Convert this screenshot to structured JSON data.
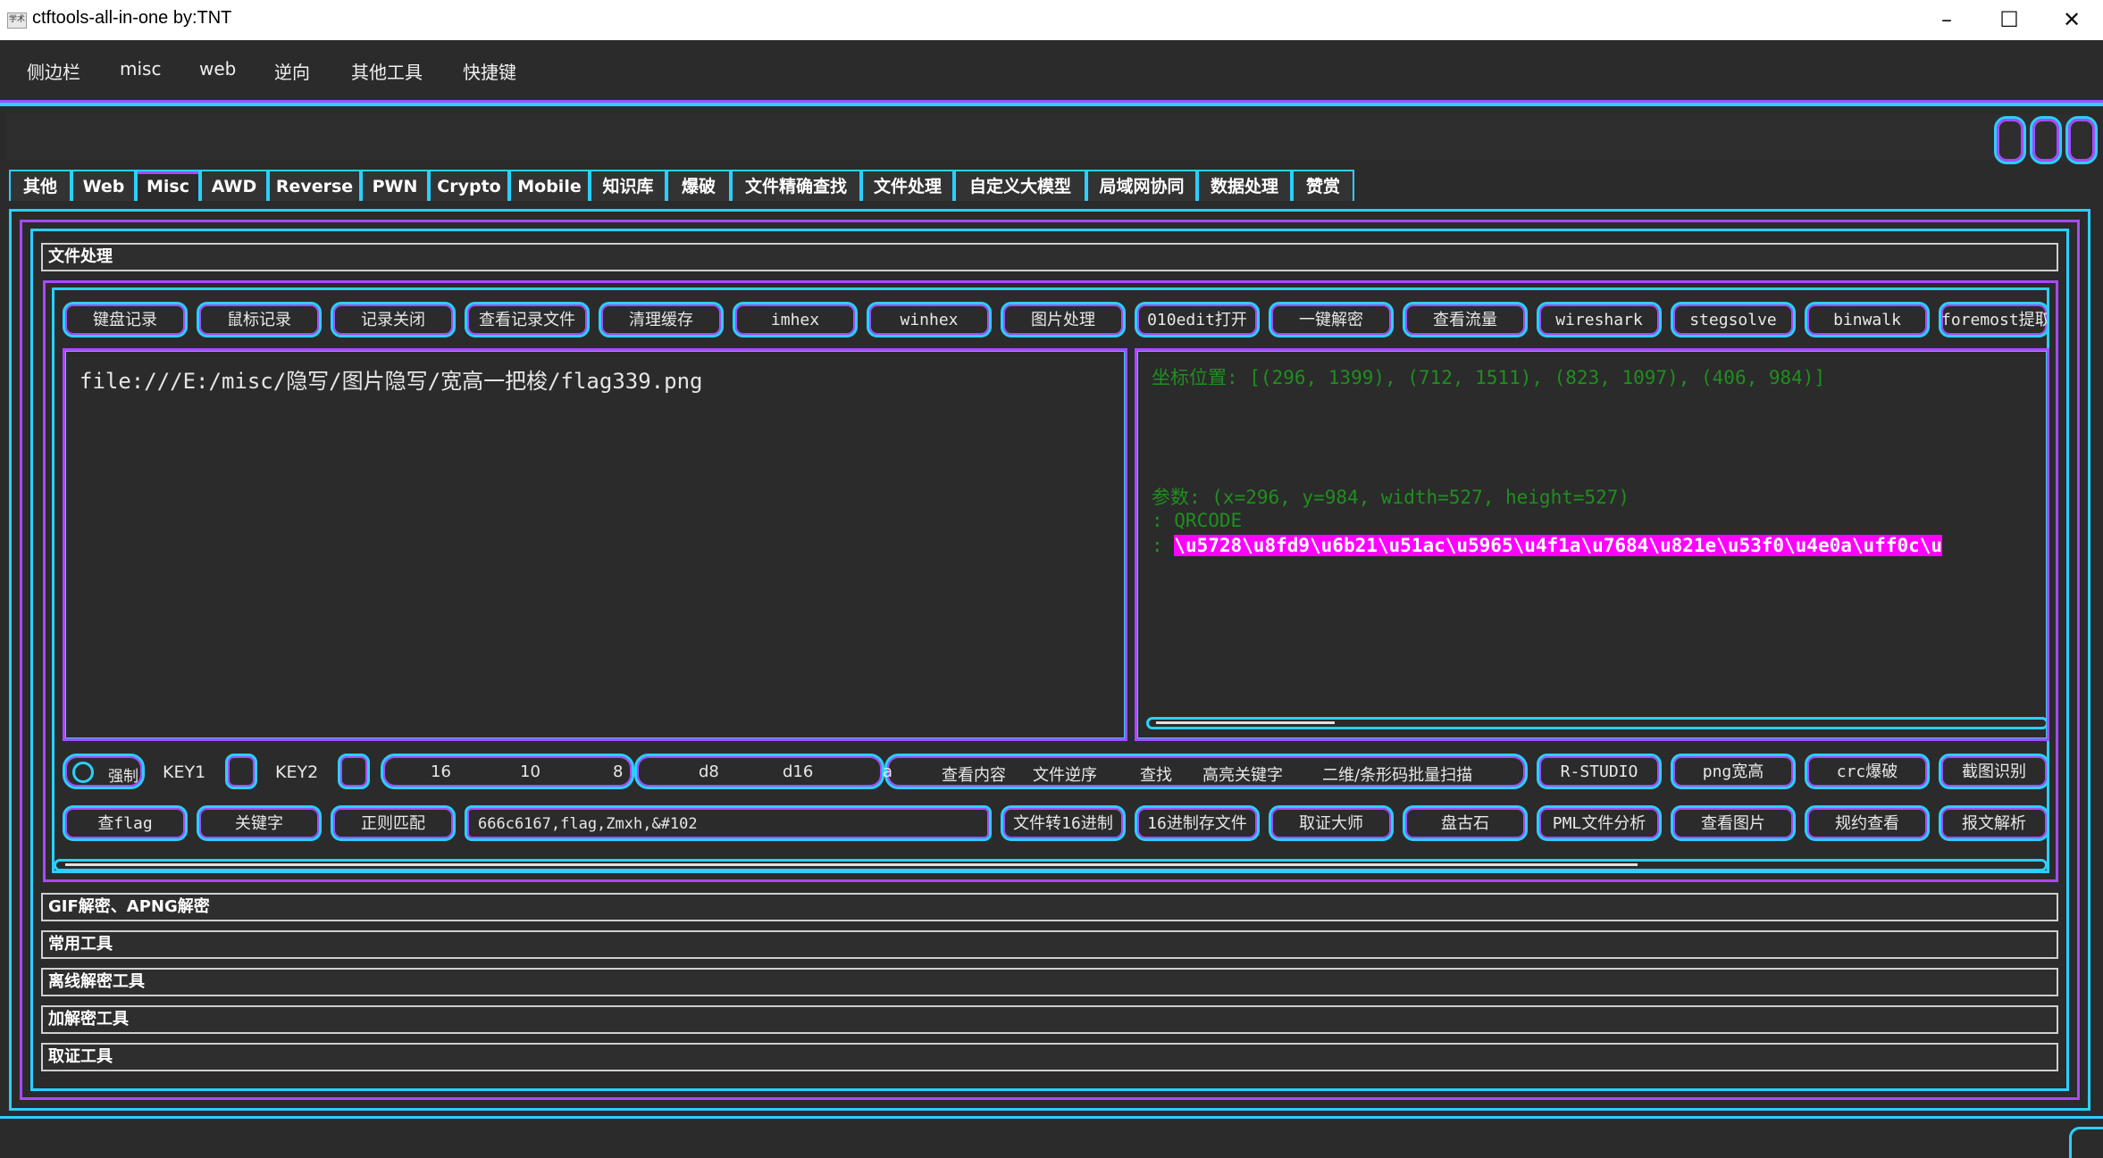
{
  "window": {
    "title": "ctftools-all-in-one   by:TNT",
    "app_icon_label": "学术"
  },
  "menu": [
    "侧边栏",
    "misc",
    "web",
    "逆向",
    "其他工具",
    "快捷键"
  ],
  "tabs": [
    "其他",
    "Web",
    "Misc",
    "AWD",
    "Reverse",
    "PWN",
    "Crypto",
    "Mobile",
    "知识库",
    "爆破",
    "文件精确查找",
    "文件处理",
    "自定义大模型",
    "局域网协同",
    "数据处理",
    "赞赏"
  ],
  "active_tab": "Misc",
  "sections": {
    "file_processing": "文件处理",
    "gif": "GIF解密、APNG解密",
    "common": "常用工具",
    "offline": "离线解密工具",
    "crypto": "加解密工具",
    "forensics": "取证工具"
  },
  "row1_buttons": [
    "键盘记录",
    "鼠标记录",
    "记录关闭",
    "查看记录文件",
    "清理缓存",
    "imhex",
    "winhex",
    "图片处理",
    "010edit打开",
    "一键解密",
    "查看流量",
    "wireshark",
    "stegsolve",
    "binwalk",
    "foremost提取"
  ],
  "left_text": "file:///E:/misc/隐写/图片隐写/宽高一把梭/flag339.png",
  "right_output": {
    "line1": "坐标位置: [(296, 1399), (712, 1511), (823, 1097), (406, 984)]",
    "line2": "参数: (x=296, y=984, width=527, height=527)",
    "line3": ": QRCODE",
    "line4_prefix": ": ",
    "line4_highlight": "\\u5728\\u8fd9\\u6b21\\u51ac\\u5965\\u4f1a\\u7684\\u821e\\u53f0\\u4e0a\\uff0c\\u"
  },
  "row3": {
    "force_label": "强制",
    "key1": "KEY1",
    "key2": "KEY2",
    "base_options": [
      "16",
      "10",
      "8",
      "d8",
      "d16",
      "a"
    ],
    "actions": [
      "查看内容",
      "文件逆序",
      "查找",
      "高亮关键字",
      "二维/条形码批量扫描",
      "R-STUDIO",
      "png宽高",
      "crc爆破",
      "截图识别"
    ]
  },
  "row4": {
    "buttons_left": [
      "查flag",
      "关键字",
      "正则匹配"
    ],
    "search_value": "666c6167,flag,Zmxh,&#102",
    "buttons_right": [
      "文件转16进制",
      "16进制存文件",
      "取证大师",
      "盘古石",
      "PML文件分析",
      "查看图片",
      "规约查看",
      "报文解析"
    ]
  },
  "colors": {
    "cyan": "#2ad0ff",
    "purple": "#a64bff",
    "green": "#1f8f1f",
    "highlight": "#ff00ff"
  }
}
